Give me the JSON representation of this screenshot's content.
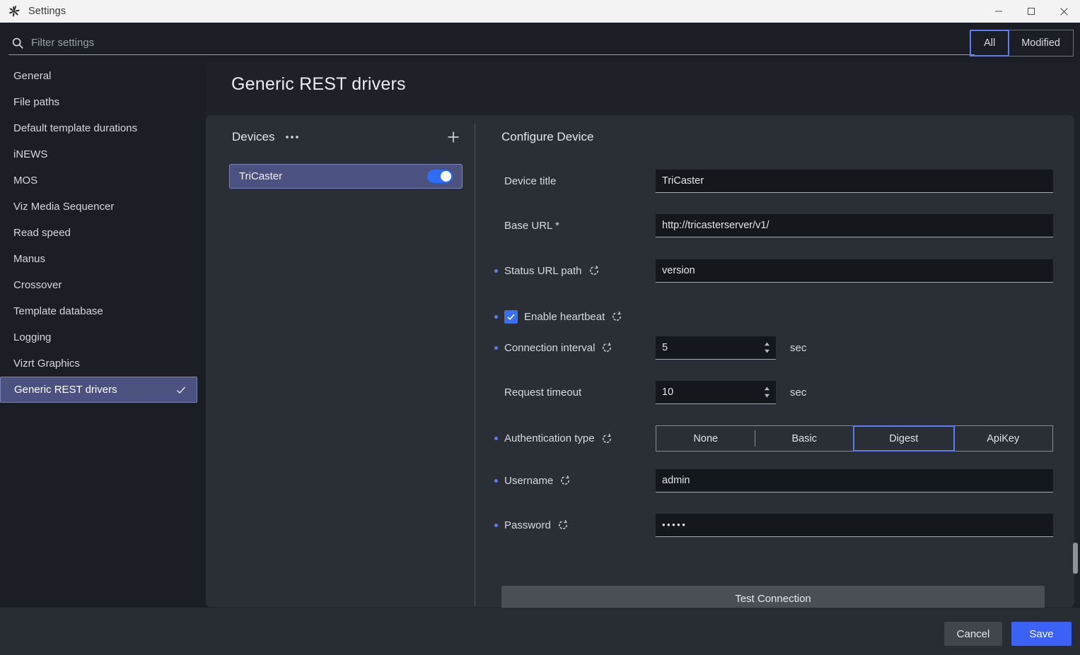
{
  "window": {
    "title": "Settings",
    "logo_icon": "pinwheel-logo-icon",
    "minimize_icon": "minimize-icon",
    "maximize_icon": "maximize-icon",
    "close_icon": "close-icon"
  },
  "filter_bar": {
    "search_icon": "search-icon",
    "search_value": "",
    "search_placeholder": "Filter settings",
    "scope": {
      "options": [
        "All",
        "Modified"
      ],
      "selected": "All"
    }
  },
  "sidebar": {
    "items": [
      {
        "label": "General",
        "selected": false
      },
      {
        "label": "File paths",
        "selected": false
      },
      {
        "label": "Default template durations",
        "selected": false
      },
      {
        "label": "iNEWS",
        "selected": false
      },
      {
        "label": "MOS",
        "selected": false
      },
      {
        "label": "Viz Media Sequencer",
        "selected": false
      },
      {
        "label": "Read speed",
        "selected": false
      },
      {
        "label": "Manus",
        "selected": false
      },
      {
        "label": "Crossover",
        "selected": false
      },
      {
        "label": "Template database",
        "selected": false
      },
      {
        "label": "Logging",
        "selected": false
      },
      {
        "label": "Vizrt Graphics",
        "selected": false
      },
      {
        "label": "Generic REST drivers",
        "selected": true,
        "check_icon": "check-icon"
      }
    ]
  },
  "page": {
    "title": "Generic REST drivers"
  },
  "devices": {
    "header_label": "Devices",
    "more_icon": "ellipsis-icon",
    "add_icon": "plus-icon",
    "items": [
      {
        "name": "TriCaster",
        "selected": true,
        "enabled": true
      }
    ]
  },
  "configure": {
    "title": "Configure Device",
    "reset_icon": "reset-icon",
    "fields": {
      "device_title": {
        "label": "Device title",
        "value": "TriCaster",
        "modified": false,
        "has_reset": false
      },
      "base_url": {
        "label": "Base URL *",
        "value": "http://tricasterserver/v1/",
        "modified": false,
        "has_reset": false
      },
      "status_url_path": {
        "label": "Status URL path",
        "value": "version",
        "modified": true,
        "has_reset": true
      },
      "enable_heartbeat": {
        "label": "Enable heartbeat",
        "checked": true,
        "modified": true,
        "has_reset": true,
        "check_icon": "check-icon"
      },
      "connection_interval": {
        "label": "Connection interval",
        "value": "5",
        "unit": "sec",
        "modified": true,
        "has_reset": true,
        "spinner_icon": "spinner-arrows-icon"
      },
      "request_timeout": {
        "label": "Request timeout",
        "value": "10",
        "unit": "sec",
        "modified": false,
        "has_reset": false,
        "spinner_icon": "spinner-arrows-icon"
      },
      "authentication_type": {
        "label": "Authentication type",
        "options": [
          "None",
          "Basic",
          "Digest",
          "ApiKey"
        ],
        "selected": "Digest",
        "modified": true,
        "has_reset": true
      },
      "username": {
        "label": "Username",
        "value": "admin",
        "modified": true,
        "has_reset": true
      },
      "password": {
        "label": "Password",
        "value": "•••••",
        "modified": true,
        "has_reset": true
      }
    },
    "test_connection_label": "Test Connection"
  },
  "footer": {
    "cancel_label": "Cancel",
    "save_label": "Save"
  },
  "colors": {
    "accent_blue": "#3b61f5",
    "selection_purple": "#4b5280",
    "focus_border": "#5b7cfa",
    "window_bg": "#1e2128",
    "panel_bg": "#2a2e35",
    "field_bg": "#14171c"
  }
}
